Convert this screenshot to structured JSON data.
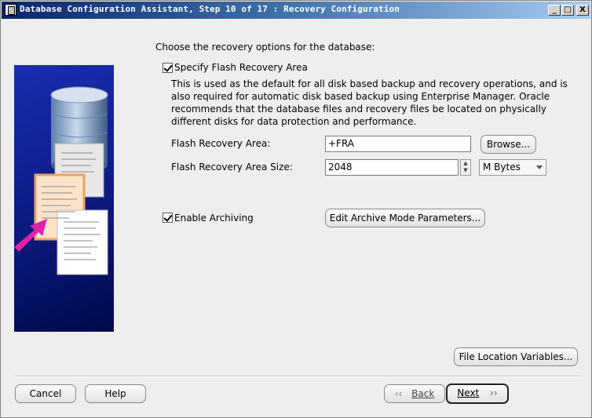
{
  "window": {
    "title": "Database Configuration Assistant, Step 10 of 17 : Recovery Configuration",
    "min_glyph": "_",
    "max_glyph": "□",
    "close_glyph": "X"
  },
  "main": {
    "intro": "Choose the recovery options for the database:",
    "flash": {
      "checkbox_label": "Specify Flash Recovery Area",
      "checked": true,
      "description": "This is used as the default for all disk based backup and recovery operations, and is also required for automatic disk based backup using Enterprise Manager. Oracle recommends that the database files and recovery files be located on physically different disks for data protection and performance.",
      "area_label": "Flash Recovery Area:",
      "area_value": "+FRA",
      "browse_label": "Browse...",
      "size_label": "Flash Recovery Area Size:",
      "size_value": "2048",
      "unit_value": "M Bytes"
    },
    "archiving": {
      "checkbox_label": "Enable Archiving",
      "checked": true,
      "edit_button_label": "Edit Archive Mode Parameters..."
    },
    "file_location_button": "File Location Variables..."
  },
  "footer": {
    "cancel_label": "Cancel",
    "help_label": "Help",
    "back_label": "Back",
    "next_label": "Next"
  },
  "icons": [
    "app-icon",
    "database-cylinder-icon",
    "document-stack-icon",
    "pointer-arrow-icon",
    "check-icon",
    "spin-up-icon",
    "spin-down-icon",
    "chevron-left-icon",
    "chevron-right-icon",
    "dropdown-arrow-icon"
  ],
  "colors": {
    "titlebar_start": "#0a246a",
    "titlebar_end": "#a6caf0",
    "panel_background": "#eeeeee",
    "art_blue": "#1a2fb0",
    "arrow_magenta": "#e020a8"
  }
}
